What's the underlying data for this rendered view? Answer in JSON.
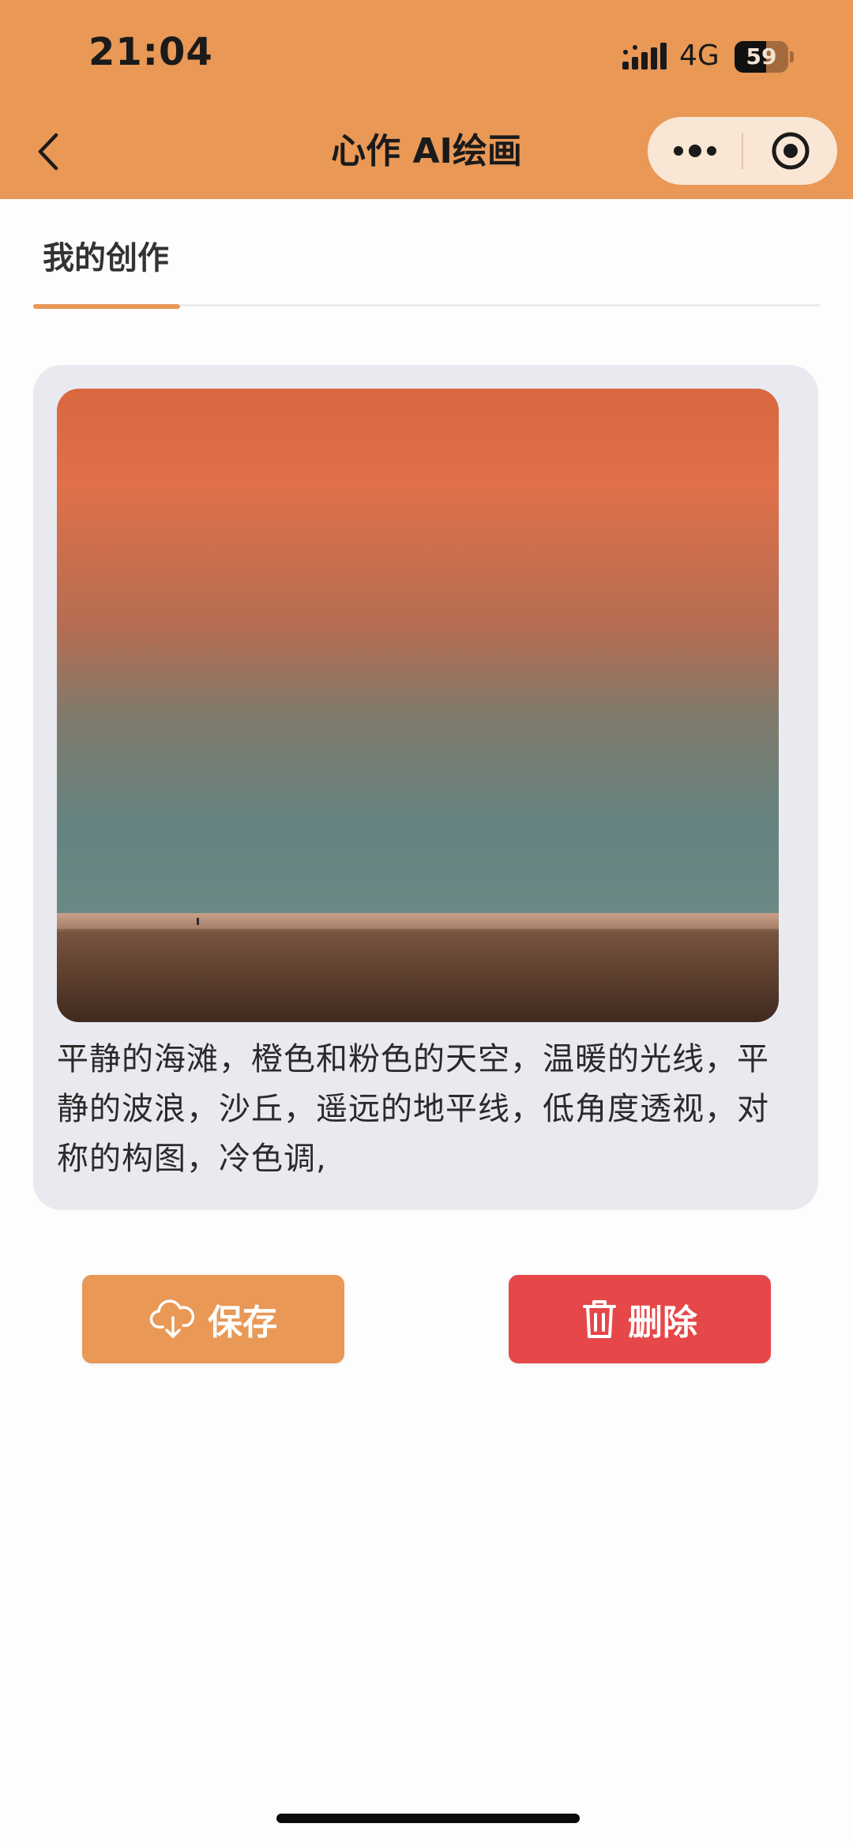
{
  "status_bar": {
    "time": "21:04",
    "network": "4G",
    "battery_level": "59",
    "battery_fraction": 0.59,
    "icons": [
      "signal-icon",
      "battery-icon"
    ]
  },
  "nav": {
    "title": "心作 AI绘画",
    "back_icon": "chevron-left-icon",
    "menu_icon": "more-dots-icon",
    "close_icon": "target-circle-icon"
  },
  "tabs": [
    {
      "label": "我的创作",
      "active": true
    }
  ],
  "creation": {
    "prompt": "平静的海滩，橙色和粉色的天空，温暖的光线，平静的波浪，沙丘，遥远的地平线，低角度透视，对称的构图，冷色调,"
  },
  "actions": {
    "save_label": "保存",
    "save_icon": "cloud-download-icon",
    "delete_label": "删除",
    "delete_icon": "trash-icon"
  },
  "colors": {
    "accent": "#e99856",
    "danger": "#e64749",
    "card_bg": "#e9eaef"
  }
}
